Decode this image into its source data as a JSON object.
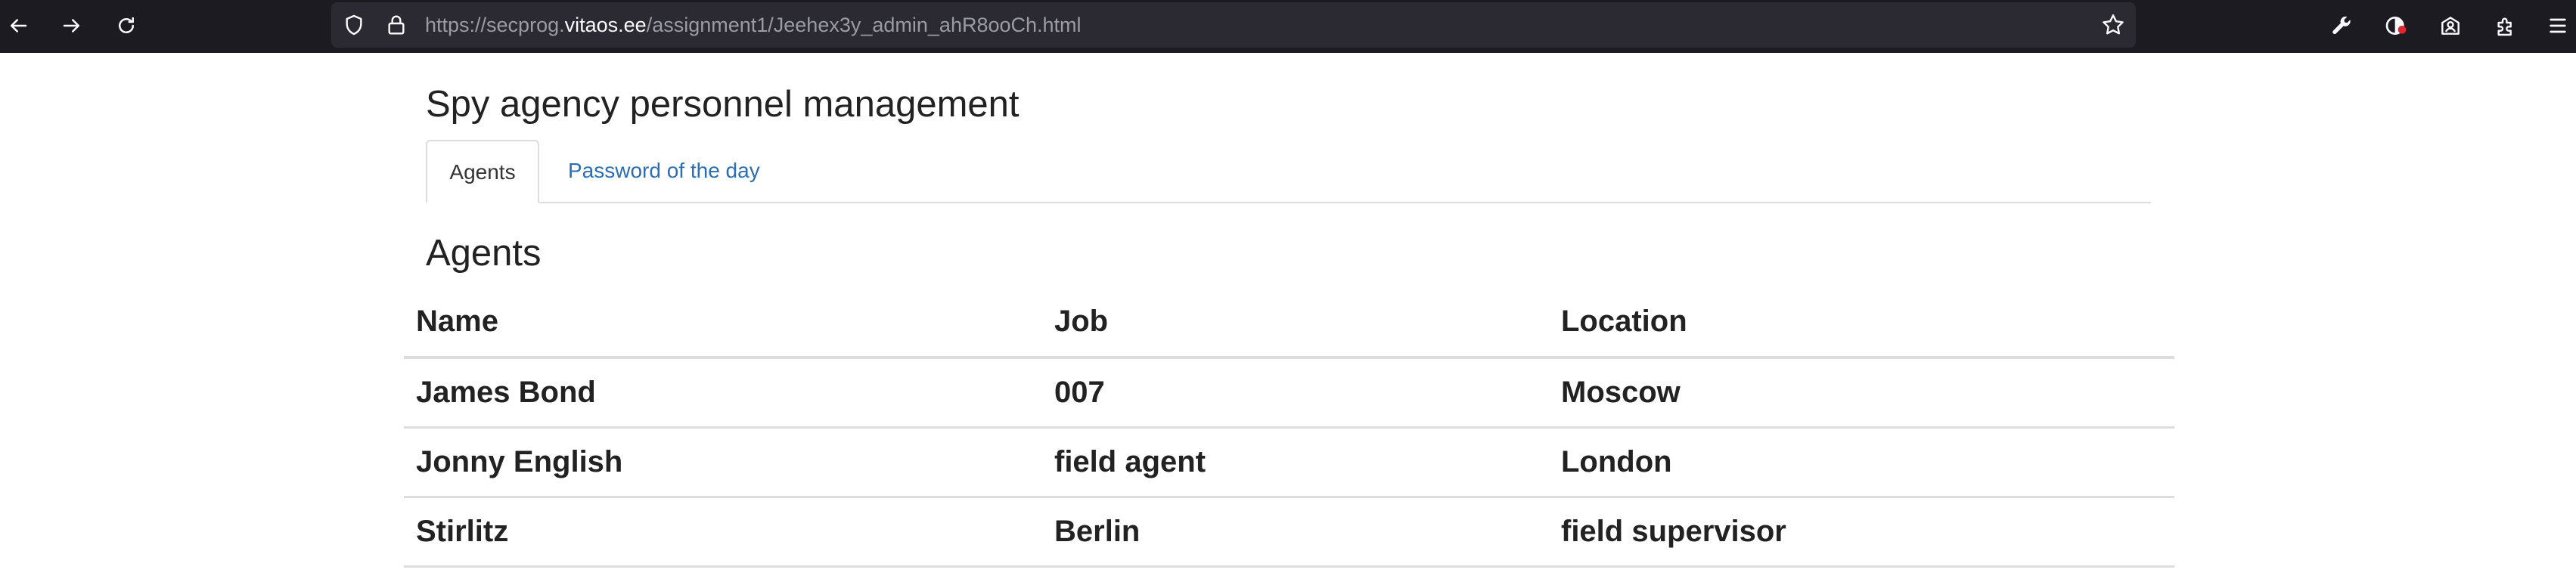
{
  "browser": {
    "url_prefix": "https://secprog.",
    "url_host": "vitaos.ee",
    "url_path": "/assignment1/Jeehex3y_admin_ahR8ooCh.html"
  },
  "page": {
    "title": "Spy agency personnel management",
    "tabs": [
      {
        "label": "Agents",
        "active": true
      },
      {
        "label": "Password of the day",
        "active": false
      }
    ],
    "section_heading": "Agents"
  },
  "table": {
    "headers": [
      "Name",
      "Job",
      "Location"
    ],
    "rows": [
      [
        "James Bond",
        "007",
        "Moscow"
      ],
      [
        "Jonny English",
        "field agent",
        "London"
      ],
      [
        "Stirlitz",
        "Berlin",
        "field supervisor"
      ]
    ]
  },
  "colors": {
    "toolbar_bg": "#1c1b22",
    "url_field_bg": "#2b2a33",
    "link": "#2a6fb3",
    "text": "#222222",
    "divider": "#dddddd"
  },
  "icons": [
    "back-icon",
    "forward-icon",
    "reload-icon",
    "shield-icon",
    "lock-icon",
    "bookmark-star-icon",
    "wrench-icon",
    "extension-badge-icon",
    "account-icon",
    "extensions-icon",
    "menu-icon"
  ]
}
